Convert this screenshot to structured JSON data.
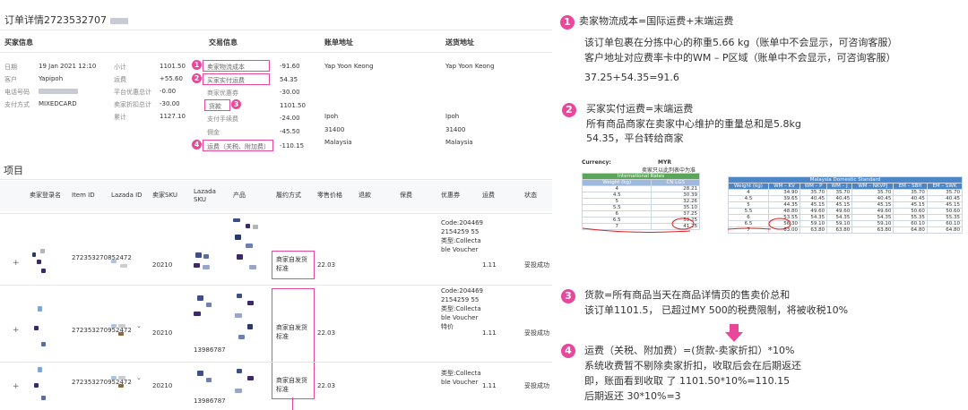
{
  "order": {
    "title": "订单详情2723532707"
  },
  "sections": {
    "buyer": "买家信息",
    "trade": "交易信息",
    "bill": "账单地址",
    "ship": "送货地址"
  },
  "buyer": {
    "date_label": "日期",
    "date": "19 Jan 2021 12:10",
    "customer_label": "客户",
    "customer": "Yapipoh",
    "phone_label": "电话号码",
    "payment_label": "支付方式",
    "payment": "MIXEDCARD"
  },
  "trade_left": [
    {
      "label": "小计",
      "value": "1101.50"
    },
    {
      "label": "运费",
      "value": "+55.60"
    },
    {
      "label": "平台优惠总计",
      "value": "-0.00"
    },
    {
      "label": "卖家折扣总计",
      "value": "-30.00"
    },
    {
      "label": "累计",
      "value": "1127.10"
    }
  ],
  "trade_right": [
    {
      "label": "卖家物流成本",
      "value": "-91.60"
    },
    {
      "label": "买家实付运费",
      "value": "54.35"
    },
    {
      "label": "商家优惠券",
      "value": "-30.00"
    },
    {
      "label": "货款",
      "value": "1101.50"
    },
    {
      "label": "支付手续费",
      "value": "-24.00"
    },
    {
      "label": "佣金",
      "value": "-45.50"
    },
    {
      "label": "运费（关税、附加费）",
      "value": "-110.15"
    }
  ],
  "bill_addr": {
    "name": "Yap Yoon Keong",
    "city": "Ipoh",
    "zip": "31400",
    "country": "Malaysia"
  },
  "ship_addr": {
    "name": "Yap Yoon Keong",
    "city": "Ipoh",
    "zip": "31400",
    "country": "Malaysia"
  },
  "items_title": "项目",
  "table_headers": [
    "卖家登录名",
    "Item ID",
    "Lazada ID",
    "卖家SKU",
    "Lazada SKU",
    "产品",
    "履约方式",
    "零售价格",
    "退款",
    "保费",
    "优惠券",
    "运费",
    "状态"
  ],
  "rows": [
    {
      "expand": "+",
      "item_id": "272353270852472",
      "sku": "20210",
      "lazada_sku": "",
      "fulfil": "商家自发货标准",
      "price": "22.03",
      "coupon": "Code:2044692154259 55 类型:Collectable Voucher",
      "ship": "1.11",
      "status": "妥投成功"
    },
    {
      "expand": "+",
      "item_id": "272353270952472",
      "sku": "20210",
      "lazada_sku": "13986787",
      "fulfil": "商家自发货标准",
      "price": "22.03",
      "coupon": "Code:2044692154259 55 类型:Collectable Voucher 特价",
      "ship": "1.11",
      "status": "妥投成功"
    },
    {
      "expand": "+",
      "item_id": "272353270952472",
      "sku": "20210",
      "lazada_sku": "13986787",
      "fulfil": "商家自发货标准",
      "price": "22.03",
      "coupon": "类型:Collectable Voucher",
      "ship": "1.11",
      "status": "妥投成功"
    }
  ],
  "annotations": {
    "a1": {
      "num": "1",
      "title": "卖家物流成本=国际运费+末端运费",
      "l1": "该订单包裹在分拣中心的称重5.66 kg（账单中不会显示，可咨询客服）",
      "l2": "客户地址对应费率卡中的WM – P区域（账单中不会显示，可咨询客服）",
      "l3": "37.25+54.35=91.6"
    },
    "a2": {
      "num": "2",
      "title": "买家实付运费=末端运费",
      "l1": "所有商品商家在卖家中心维护的重量总和是5.8kg",
      "l2": "54.35，平台转给商家"
    },
    "a3": {
      "num": "3",
      "title": "货款=所有商品当天在商品详情页的售卖价总和",
      "l1": "该订单1101.5， 已超过MY 500的税费限制，将被收税10%"
    },
    "a4": {
      "num": "4",
      "title": "运费（关税、附加费）=(货款-卖家折扣）*10%",
      "l1": "系统收费暂不剔除卖家折扣，收取后会在后期返还",
      "l2": "即，账面看到收取 了 1101.50*10%=110.15",
      "l3": "后期返还 30*10%=3"
    }
  },
  "rate_table": {
    "currency_label": "Currency:",
    "currency": "MYR",
    "note": "卖家只以此列表中为准",
    "intl_title": "International Rates",
    "weight_header": "Weight (kg)",
    "cn_header": "CN LGS",
    "weights": [
      "4",
      "4.5",
      "5",
      "5.5",
      "6",
      "6.5",
      "7"
    ],
    "cn_lgs": [
      "28.21",
      "30.39",
      "32.26",
      "35.10",
      "37.25",
      "39.25",
      "41.25"
    ],
    "dom_title": "Malaysia Domestic Standard",
    "dom_headers": [
      "Weight (kg)",
      "WM – KV",
      "WM – P",
      "WM – J",
      "WM – NKVPJ",
      "EM – SBH",
      "EM – SWK"
    ],
    "dom_rows": [
      [
        "4",
        "34.90",
        "35.70",
        "35.70",
        "35.70",
        "35.70",
        "35.70"
      ],
      [
        "4.5",
        "39.65",
        "40.45",
        "40.45",
        "40.45",
        "40.45",
        "40.45"
      ],
      [
        "5",
        "44.35",
        "45.15",
        "45.15",
        "45.15",
        "45.15",
        "45.15"
      ],
      [
        "5.5",
        "48.80",
        "49.60",
        "49.60",
        "49.60",
        "50.60",
        "50.60"
      ],
      [
        "6",
        "53.55",
        "54.35",
        "54.35",
        "54.35",
        "55.35",
        "55.35"
      ],
      [
        "6.5",
        "56.30",
        "59.10",
        "59.10",
        "59.10",
        "60.10",
        "60.10"
      ],
      [
        "7",
        "63.00",
        "63.80",
        "63.80",
        "63.80",
        "64.80",
        "64.80"
      ]
    ]
  },
  "colors": {
    "accent": "#e8479a",
    "table_blue": "#4a86c8",
    "table_green": "#5aa55a",
    "arrow": "#e8479a"
  }
}
